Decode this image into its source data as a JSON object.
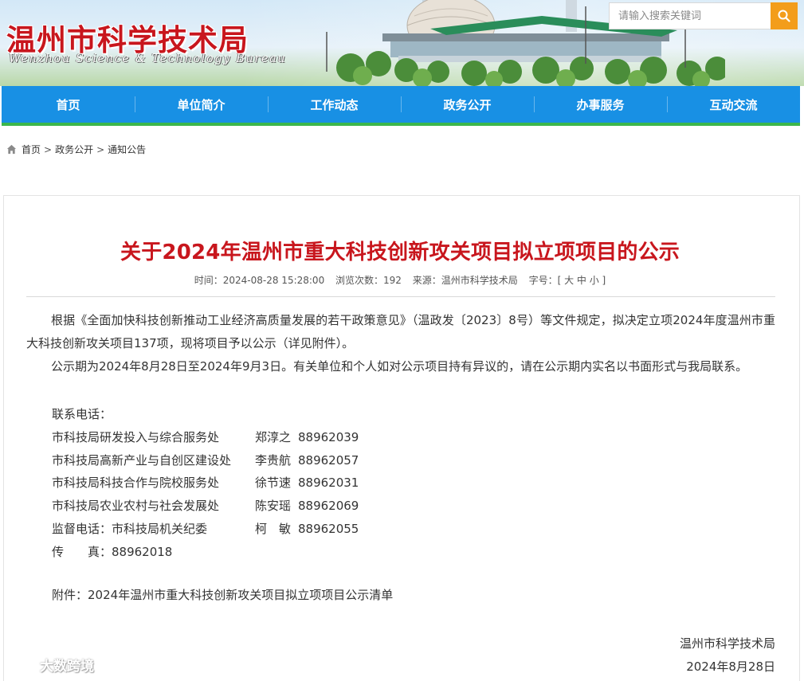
{
  "header": {
    "logo_cn": "温州市科学技术局",
    "logo_en": "Wenzhou Science & Technology Bureau",
    "search_placeholder": "请输入搜索关键词"
  },
  "nav": {
    "items": [
      "首页",
      "单位简介",
      "工作动态",
      "政务公开",
      "办事服务",
      "互动交流"
    ]
  },
  "breadcrumb": {
    "items": [
      "首页",
      "政务公开",
      "通知公告"
    ],
    "separator": ">"
  },
  "article": {
    "title": "关于2024年温州市重大科技创新攻关项目拟立项项目的公示",
    "meta": {
      "time": "时间：2024-08-28 15:28:00",
      "views": "浏览次数：192",
      "source": "来源：温州市科学技术局",
      "font_size": "字号：[ 大 中 小 ]"
    },
    "paragraphs": [
      "根据《全面加快科技创新推动工业经济高质量发展的若干政策意见》（温政发〔2023〕8号）等文件规定，拟决定立项2024年度温州市重大科技创新攻关项目137项，现将项目予以公示（详见附件）。",
      "公示期为2024年8月28日至2024年9月3日。有关单位和个人如对公示项目持有异议的，请在公示期内实名以书面形式与我局联系。"
    ],
    "contact_label": "联系电话：",
    "contacts": [
      {
        "dept": "市科技局研发投入与综合服务处",
        "name": "郑淳之",
        "phone": "88962039"
      },
      {
        "dept": "市科技局高新产业与自创区建设处",
        "name": "李贵航",
        "phone": "88962057"
      },
      {
        "dept": "市科技局科技合作与院校服务处",
        "name": "徐节速",
        "phone": "88962031"
      },
      {
        "dept": "市科技局农业农村与社会发展处",
        "name": "陈安瑶",
        "phone": "88962069"
      },
      {
        "dept": "监督电话：市科技局机关纪委",
        "name": "柯　敏",
        "phone": "88962055"
      }
    ],
    "fax": "传　　真：88962018",
    "attachment_label": "附件：",
    "attachment": "2024年温州市重大科技创新攻关项目拟立项项目公示清单",
    "signature_org": "温州市科学技术局",
    "signature_date": "2024年8月28日"
  },
  "watermark": "大数跨境",
  "colors": {
    "brand_red": "#c8161d",
    "nav_blue": "#1890e4",
    "nav_green": "#3cb64c",
    "search_orange": "#f39d1b"
  }
}
